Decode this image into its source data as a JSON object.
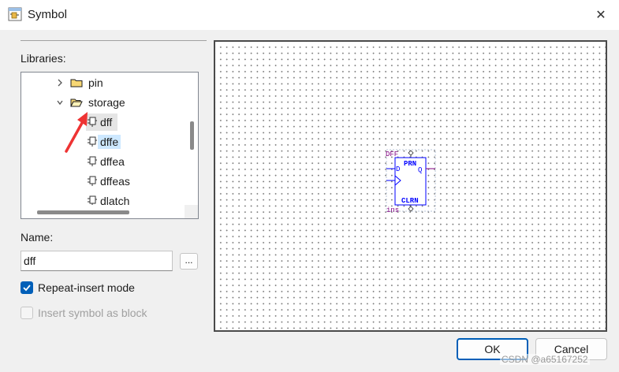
{
  "window": {
    "title": "Symbol",
    "close_glyph": "✕"
  },
  "libraries": {
    "label": "Libraries:",
    "items": [
      {
        "label": "pin",
        "kind": "folder",
        "state": "collapsed"
      },
      {
        "label": "storage",
        "kind": "folder",
        "state": "expanded"
      },
      {
        "label": "dff",
        "kind": "symbol",
        "state": "hover"
      },
      {
        "label": "dffe",
        "kind": "symbol",
        "state": "selected"
      },
      {
        "label": "dffea",
        "kind": "symbol",
        "state": "normal"
      },
      {
        "label": "dffeas",
        "kind": "symbol",
        "state": "normal"
      },
      {
        "label": "dlatch",
        "kind": "symbol",
        "state": "normal"
      }
    ]
  },
  "name": {
    "label": "Name:",
    "value": "dff",
    "browse_label": "..."
  },
  "options": {
    "repeat_insert": {
      "label": "Repeat-insert mode",
      "checked": true
    },
    "insert_as_block": {
      "label": "Insert symbol as block",
      "checked": false,
      "disabled": true
    }
  },
  "preview": {
    "symbol_type": "DFF",
    "instance": "ins",
    "pins": {
      "d": "D",
      "prn": "PRN",
      "q": "Q",
      "clrn": "CLRN"
    }
  },
  "buttons": {
    "ok": "OK",
    "cancel": "Cancel"
  },
  "watermark": "CSDN @a65167252",
  "colors": {
    "accent": "#005fb8",
    "symbol": "#800080",
    "symbol_blue": "#0000ff",
    "annotation": "#ee3333"
  }
}
